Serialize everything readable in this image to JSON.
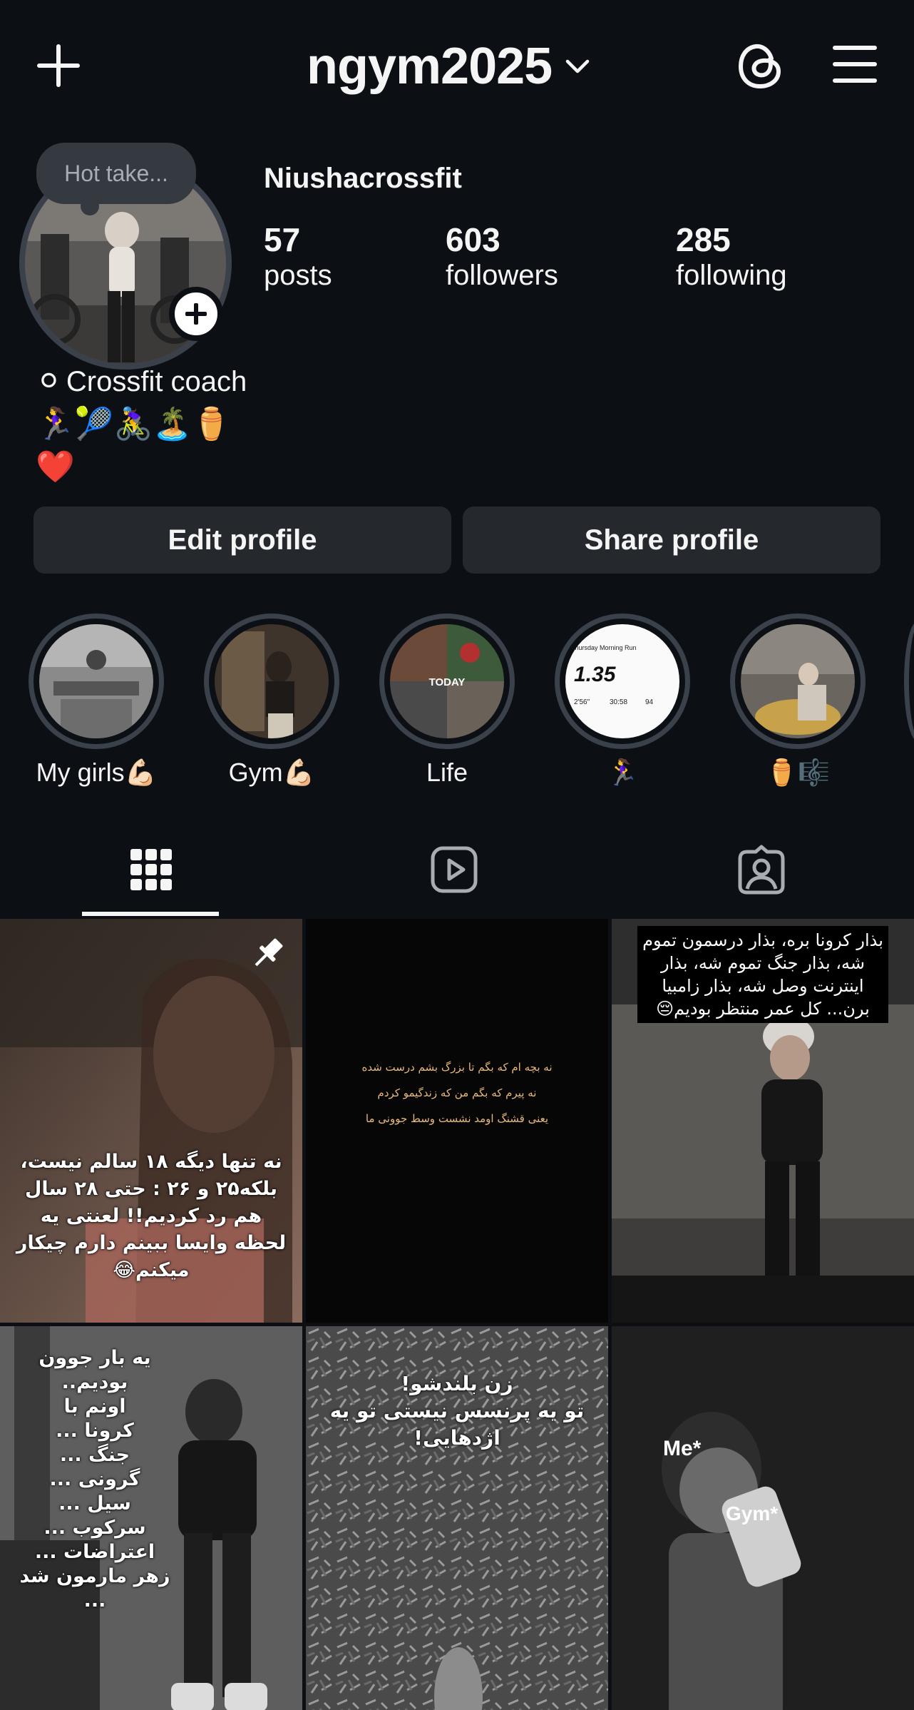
{
  "header": {
    "username": "ngym2025",
    "icons": {
      "add": "plus-icon",
      "dropdown": "chevron-down-icon",
      "threads": "threads-icon",
      "menu": "hamburger-menu-icon"
    }
  },
  "profile": {
    "note": "Hot take...",
    "display_name": "Niushacrossfit",
    "stats": {
      "posts": {
        "value": "57",
        "label": "posts"
      },
      "followers": {
        "value": "603",
        "label": "followers"
      },
      "following": {
        "value": "285",
        "label": "following"
      }
    },
    "bio": {
      "line1_emoji": "⚪",
      "line1_text": "Crossfit coach",
      "line2_emojis": "🏃‍♀️🎾🚴‍♀️🏝️⚱️",
      "line3_emoji": "❤️"
    }
  },
  "buttons": {
    "edit": "Edit profile",
    "share": "Share profile"
  },
  "highlights": [
    {
      "label": "My girls💪🏻"
    },
    {
      "label": "Gym💪🏻"
    },
    {
      "label": "Life",
      "overlay": "TODAY"
    },
    {
      "label": "🏃‍♀️",
      "overlay_title": "Thursday Morning Run",
      "overlay_value": "1.35",
      "overlay_small": [
        "2'56\"",
        "30:58",
        "94"
      ]
    },
    {
      "label": "⚱️🎼"
    }
  ],
  "tabs": [
    {
      "name": "posts-grid",
      "icon": "grid-icon"
    },
    {
      "name": "reels",
      "icon": "reels-icon"
    },
    {
      "name": "tagged",
      "icon": "tagged-person-icon"
    }
  ],
  "posts": [
    {
      "text": "نه تنها دیگه ۱۸ سالم نیست، بلکه۲۵ و ۲۶ : حتی ۲۸ سال هم رد کردیم!! لعنتی یه لحظه وایسا ببینم دارم چیکار میکنم😂",
      "pinned": true
    },
    {
      "text": "نه بچه ام که بگم تا بزرگ بشم درست شده\nنه پیرم که بگم من که زندگیمو کردم\nیعنی قشنگ اومد نشست وسط جوونی ما"
    },
    {
      "text": "بذار کرونا بره، بذار درسمون تموم شه، بذار جنگ تموم شه، بذار اینترنت وصل شه، بذار زامبیا برن... کل عمر منتظر بودیم😔"
    },
    {
      "text": "یه بار جوون بودیم..\nاونم با\nکرونا ...\nجنگ ...\nگرونی ...\nسیل ...\nسرکوب ...\nاعتراضات ...\nزهر مارمون شد ..."
    },
    {
      "text": "زن بلندشو!\nتو یه پرنسس نیستی تو یه اژدهایی!"
    },
    {
      "text1": "Me*",
      "text2": "Gym*"
    }
  ]
}
